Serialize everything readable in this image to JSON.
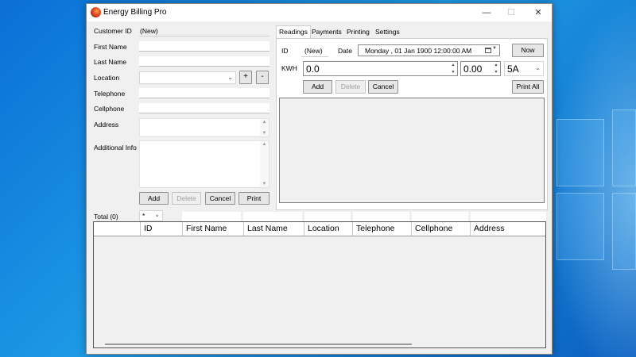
{
  "window": {
    "title": "Energy Billing Pro"
  },
  "titlebar": {
    "minimize": "—",
    "maximize": "☐",
    "close": "✕"
  },
  "customer": {
    "id_label": "Customer ID",
    "id_value": "(New)",
    "first_name_label": "First Name",
    "last_name_label": "Last Name",
    "location_label": "Location",
    "telephone_label": "Telephone",
    "cellphone_label": "Cellphone",
    "address_label": "Address",
    "additional_label": "Additional Info",
    "plus": "+",
    "minus": "-",
    "buttons": {
      "add": "Add",
      "delete": "Delete",
      "cancel": "Cancel",
      "print": "Print"
    }
  },
  "tabs": [
    "Readings",
    "Payments",
    "Printing",
    "Settings"
  ],
  "readings": {
    "id_label": "ID",
    "id_value": "(New)",
    "date_label": "Date",
    "date_value": "Monday    , 01 Jan  1900 12:00:00 AM",
    "now": "Now",
    "kwh_label": "KWH",
    "kwh_value": "0.0",
    "amount_value": "0.00",
    "rate_value": "5A",
    "buttons": {
      "add": "Add",
      "delete": "Delete",
      "cancel": "Cancel",
      "print_all": "Print All"
    }
  },
  "list": {
    "total": "Total (0)",
    "filter": "*",
    "columns": [
      "ID",
      "First Name",
      "Last Name",
      "Location",
      "Telephone",
      "Cellphone",
      "Address"
    ]
  }
}
